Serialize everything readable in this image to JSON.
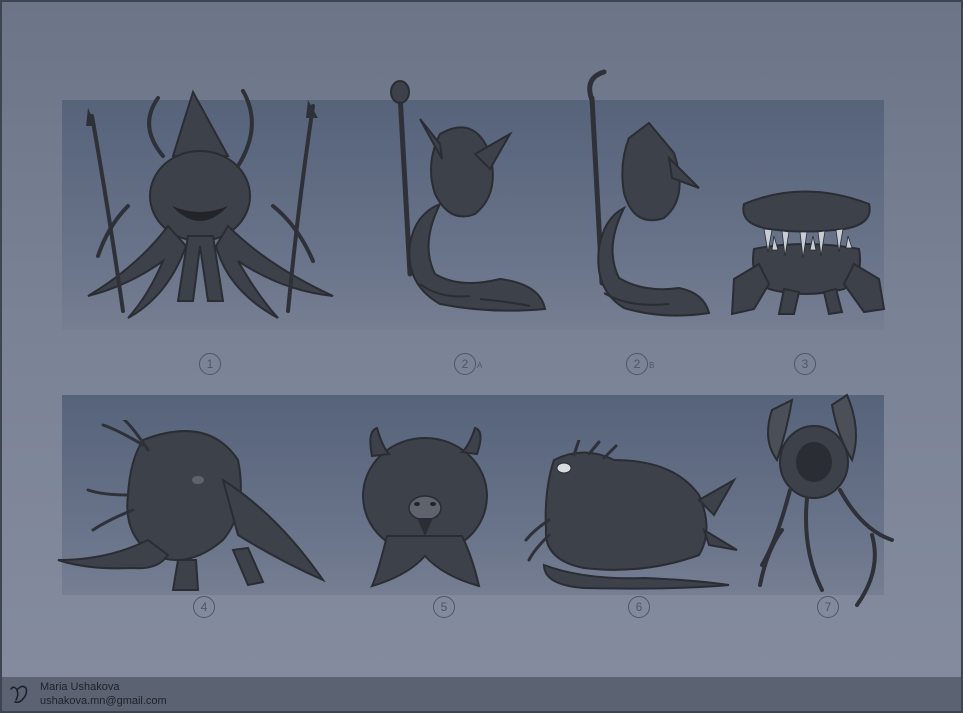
{
  "labels": {
    "c1": "1",
    "c2a": "2",
    "c2a_sub": "A",
    "c2b": "2",
    "c2b_sub": "B",
    "c3": "3",
    "c4": "4",
    "c5": "5",
    "c6": "6",
    "c7": "7"
  },
  "footer": {
    "author": "Maria Ushakova",
    "email": "ushakova.mn@gmail.com",
    "logo_icon": "signature-icon"
  },
  "colors": {
    "creature_fill": "#3d4149",
    "creature_dark": "#2a2d33",
    "creature_light": "#5e636d",
    "label": "#4f5666"
  }
}
